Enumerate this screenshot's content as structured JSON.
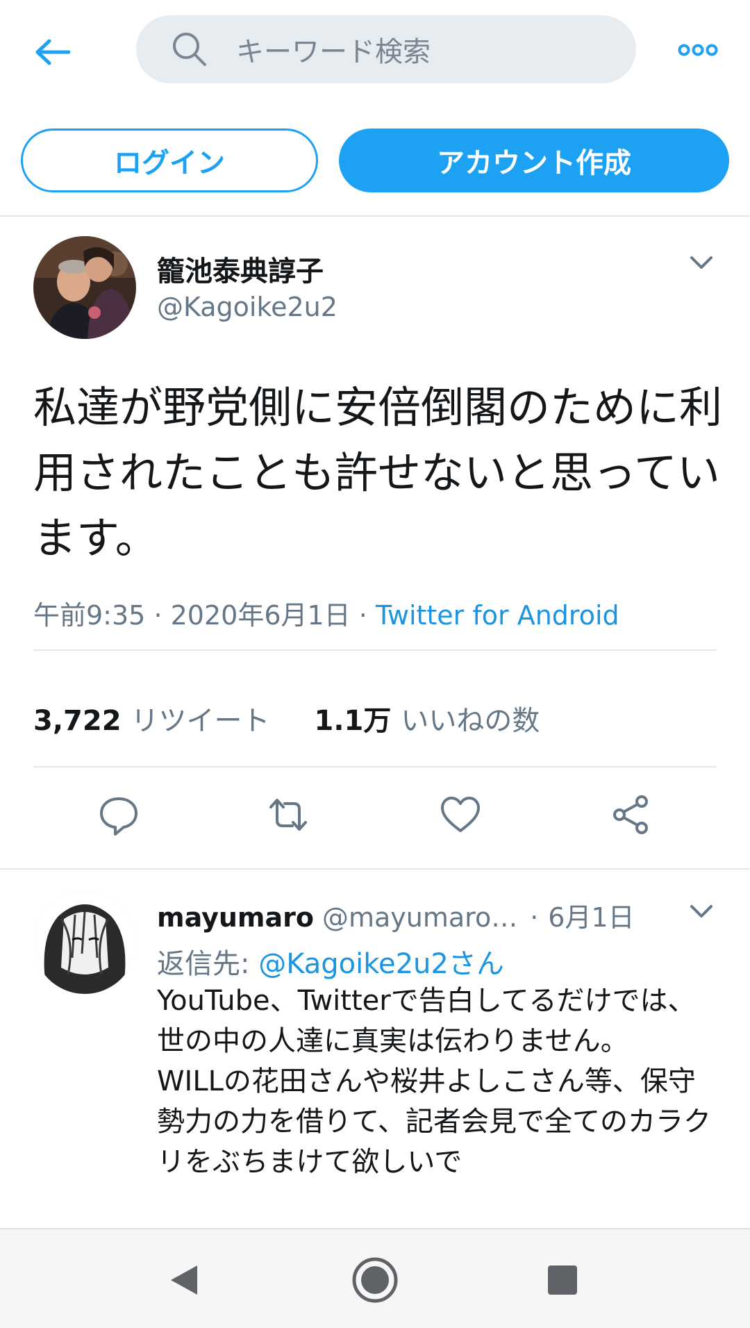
{
  "search": {
    "placeholder": "キーワード検索"
  },
  "auth": {
    "login_label": "ログイン",
    "signup_label": "アカウント作成"
  },
  "tweet": {
    "author_name": "籠池泰典諄子",
    "author_handle": "@Kagoike2u2",
    "text": "私達が野党側に安倍倒閣のために利用されたことも許せないと思っています。",
    "time": "午前9:35",
    "date": "2020年6月1日",
    "source": "Twitter for Android",
    "retweet_count": "3,722",
    "retweet_label": "リツイート",
    "like_count": "1.1万",
    "like_label": "いいねの数"
  },
  "reply": {
    "author_name": "mayumaro",
    "author_handle": "@mayumaro…",
    "date": "6月1日",
    "reply_to_prefix": "返信先: ",
    "reply_to_mention": "@Kagoike2u2",
    "reply_to_suffix": "さん",
    "text": "YouTube、Twitterで告白してるだけでは、世の中の人達に真実は伝わりません。\nWILLの花田さんや桜井よしこさん等、保守勢力の力を借りて、記者会見で全てのカラクリをぶちまけて欲しいで"
  },
  "colors": {
    "accent": "#1da1f2",
    "link": "#1b95e0",
    "secondary_text": "#657786"
  }
}
